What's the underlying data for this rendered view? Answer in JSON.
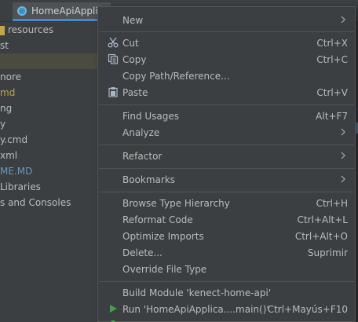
{
  "editor_tab": {
    "title": "HomeApiApplic"
  },
  "project_tree": [
    {
      "text": "resources",
      "color": "#bbbbbb"
    },
    {
      "text": "st",
      "color": "#bbbbbb"
    },
    {
      "text": "",
      "color": "#bbbbbb"
    },
    {
      "text": "nore",
      "color": "#bbbbbb"
    },
    {
      "text": "md",
      "color": "#b8a84c"
    },
    {
      "text": "ng",
      "color": "#bbbbbb"
    },
    {
      "text": "y",
      "color": "#bbbbbb"
    },
    {
      "text": "y.cmd",
      "color": "#bbbbbb"
    },
    {
      "text": "xml",
      "color": "#bbbbbb"
    },
    {
      "text": "ME.MD",
      "color": "#6897bb"
    },
    {
      "text": "Libraries",
      "color": "#bbbbbb"
    },
    {
      "text": "s and Consoles",
      "color": "#bbbbbb"
    }
  ],
  "menu": {
    "new": {
      "label": "New"
    },
    "cut": {
      "label": "Cut",
      "shortcut": "Ctrl+X"
    },
    "copy": {
      "label": "Copy",
      "shortcut": "Ctrl+C"
    },
    "copy_path": {
      "label": "Copy Path/Reference..."
    },
    "paste": {
      "label": "Paste",
      "shortcut": "Ctrl+V"
    },
    "find_usages": {
      "label": "Find Usages",
      "shortcut": "Alt+F7"
    },
    "analyze": {
      "label": "Analyze"
    },
    "refactor": {
      "label": "Refactor"
    },
    "bookmarks": {
      "label": "Bookmarks"
    },
    "browse_hierarchy": {
      "label": "Browse Type Hierarchy",
      "shortcut": "Ctrl+H"
    },
    "reformat": {
      "label": "Reformat Code",
      "shortcut": "Ctrl+Alt+L"
    },
    "optimize": {
      "label": "Optimize Imports",
      "shortcut": "Ctrl+Alt+O"
    },
    "delete": {
      "label": "Delete...",
      "shortcut": "Suprimir"
    },
    "override_type": {
      "label": "Override File Type"
    },
    "build_module": {
      "label": "Build Module 'kenect-home-api'"
    },
    "run": {
      "label": "Run 'HomeApiApplica....main()'",
      "shortcut": "Ctrl+Mayús+F10"
    }
  },
  "colors": {
    "menu_bg": "#3c3f41",
    "run_icon": "#499c54"
  }
}
